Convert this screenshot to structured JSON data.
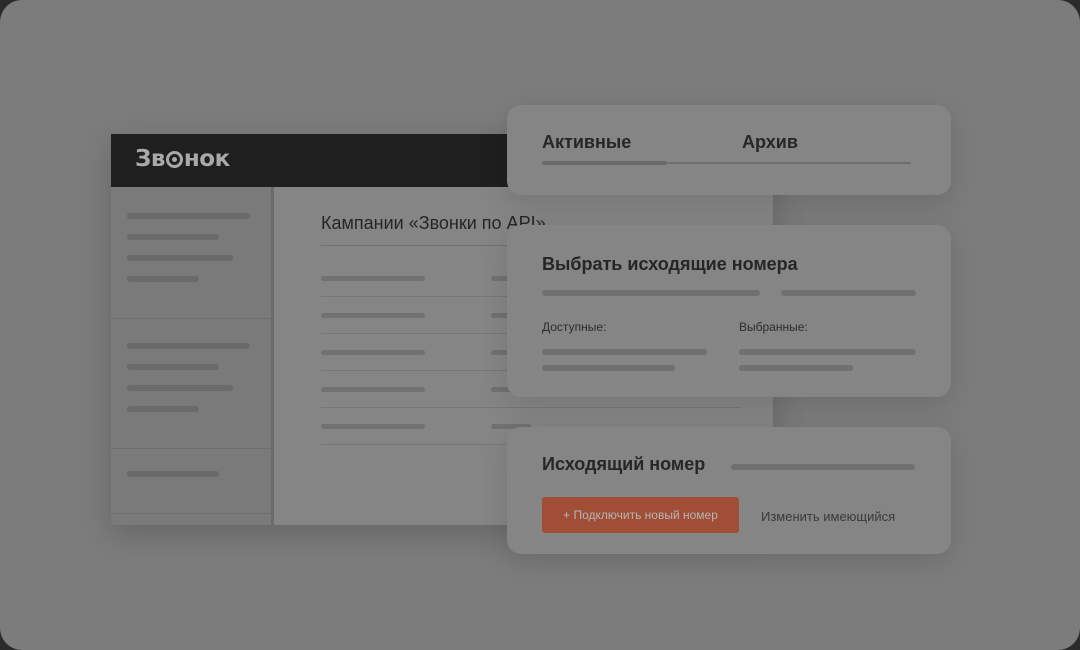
{
  "app": {
    "logo_text_pre": "Зв",
    "logo_text_post": "нок",
    "content_title": "Кампании «Звонки по API»"
  },
  "tabs_card": {
    "tab_active": "Активные",
    "tab_archive": "Архив"
  },
  "numbers_card": {
    "title": "Выбрать исходящие номера",
    "available_label": "Доступные:",
    "selected_label": "Выбранные:"
  },
  "outgoing_card": {
    "title": "Исходящий номер",
    "connect_button": "+ Подключить новый номер",
    "change_link": "Изменить имеющийся"
  },
  "colors": {
    "overlay_background": "#7c7c7c",
    "header_background": "#1f1f20",
    "accent_button": "#a04e35"
  }
}
